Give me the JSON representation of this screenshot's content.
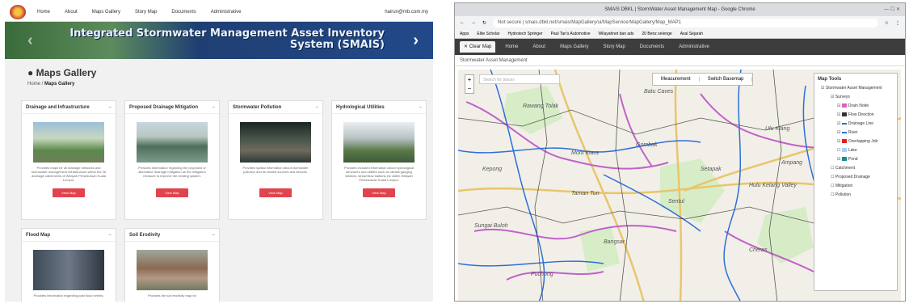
{
  "left": {
    "nav": [
      "Home",
      "About",
      "Maps Gallery",
      "Story Map",
      "Documents",
      "Administrative"
    ],
    "user": "hairun@mb.com.my",
    "banner_title_line1": "Integrated Stormwater Management Asset Inventory",
    "banner_title_line2": "System (SMAIS)",
    "gallery_title": "Maps Gallery",
    "crumb_home": "Home",
    "crumb_current": "Maps Gallery",
    "view_label": "View Map",
    "cards": [
      {
        "title": "Drainage and Infrastructure",
        "desc": "Provides maps for all drainage networks and stormwater management infrastructure within the 26 drainage catchments of Wilayah Persekutuan Kuala Lumpur."
      },
      {
        "title": "Proposed Drainage Mitigation",
        "desc": "Provides information regarding the proposed or alternative drainage mitigation as the mitigation measure to improve the existing system."
      },
      {
        "title": "Stormwater Pollution",
        "desc": "Provides spatial information about stormwater pollution and its related sources and devices."
      },
      {
        "title": "Hydrological Utilities",
        "desc": "Provides included information about hydrological structures and utilities such as rainfall gauging stations, streamflow stations etc within Wilayah Persekutuan Kuala Lumpur."
      },
      {
        "title": "Flood Map",
        "desc": "Provides information regarding past flood events."
      },
      {
        "title": "Soil Erodivity",
        "desc": "Provides the soil erodivity map for"
      }
    ]
  },
  "right": {
    "window_title": "SMAIS DBKL | StormWater Asset Management Map - Google Chrome",
    "url": "Not secure | smais.dbkl.net/smais/MapGallery/ui/MapService/MapGallery/Map_MAP1",
    "bookmarks": [
      "Apps",
      "Elite Scholar",
      "Hydrotech Springer",
      "Paul Tan's Automotive",
      "Wilayahnet dan ads",
      "20 Benz selenge",
      "Asal Sejarah"
    ],
    "tab_label": "Clear Map",
    "app_nav": [
      "Home",
      "About",
      "Maps Gallery",
      "Story Map",
      "Documents",
      "Administrative"
    ],
    "map_header": "Stormwater Asset Management",
    "search_placeholder": "Search for places",
    "toolbar": [
      "Measurement",
      "Switch Basemap"
    ],
    "maptools_title": "Map Tools",
    "layers": [
      {
        "label": "Stormwater Asset Management",
        "level": 1,
        "color": ""
      },
      {
        "label": "Surveys",
        "level": 2,
        "color": ""
      },
      {
        "label": "Drain Node",
        "level": 3,
        "color": "#e060c0"
      },
      {
        "label": "Flow Direction",
        "level": 3,
        "color": "#333333"
      },
      {
        "label": "Drainage Line",
        "level": 3,
        "color": "#2b6fd6"
      },
      {
        "label": "River",
        "level": 3,
        "color": "#2b6fd6"
      },
      {
        "label": "Overlapping Job",
        "level": 3,
        "color": "#e02020"
      },
      {
        "label": "Lake",
        "level": 3,
        "color": "#9fd2ff"
      },
      {
        "label": "Pond",
        "level": 3,
        "color": "#1a8c8c"
      },
      {
        "label": "Catchment",
        "level": 2,
        "color": ""
      },
      {
        "label": "Proposed Drainage",
        "level": 2,
        "color": ""
      },
      {
        "label": "Mitigation",
        "level": 2,
        "color": ""
      },
      {
        "label": "Pollution",
        "level": 2,
        "color": ""
      }
    ],
    "places": [
      "Batu Caves",
      "Rawang Tolak",
      "Gombak",
      "Ulu Klang",
      "Ampang",
      "Hulu Kelang Valley",
      "Taman Tun",
      "Sentul",
      "Cheras",
      "Bangsar",
      "Puchong",
      "Sungai Buloh",
      "Mont Kiara",
      "Setapak",
      "Kepong"
    ]
  }
}
